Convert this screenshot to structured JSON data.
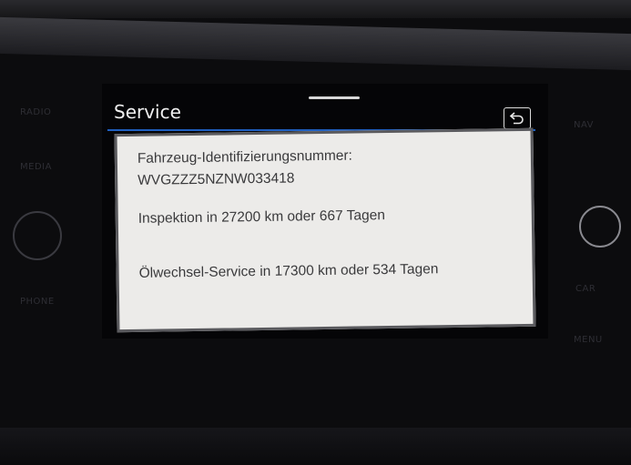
{
  "screen": {
    "title": "Service"
  },
  "service_info": {
    "vin_label": "Fahrzeug-Identifizierungsnummer:",
    "vin": "WVGZZZ5NZNW033418",
    "inspection": "Inspektion in 27200 km oder 667 Tagen",
    "oil_change": "Ölwechsel-Service in 17300 km oder 534 Tagen"
  },
  "hardware": {
    "left_buttons": [
      "RADIO",
      "MEDIA",
      "PHONE"
    ],
    "right_buttons": [
      "NAV",
      "CAR",
      "MENU"
    ]
  },
  "colors": {
    "accent": "#1f5fbf",
    "panel_bg": "#ecebe9",
    "text": "#3a3a3c"
  },
  "icons": {
    "back": "back-arrow-icon"
  }
}
